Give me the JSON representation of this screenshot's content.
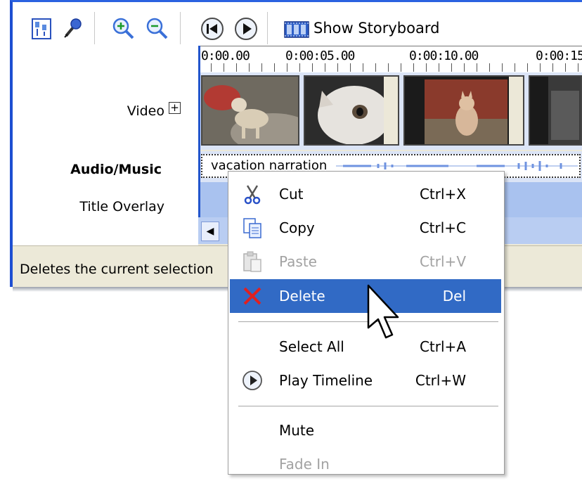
{
  "toolbar": {
    "show_storyboard_label": "Show Storyboard"
  },
  "tracks": {
    "video_label": "Video",
    "video_expand_symbol": "+",
    "audio_label": "Audio/Music",
    "title_overlay_label": "Title Overlay",
    "audio_clip_name": "vacation narration"
  },
  "ruler": {
    "ticks": [
      "0:00.00",
      "0:00:05.00",
      "0:00:10.00",
      "0:00:15"
    ]
  },
  "status": {
    "text": "Deletes the current selection"
  },
  "context_menu": {
    "items": [
      {
        "label": "Cut",
        "shortcut": "Ctrl+X",
        "icon": "scissors-icon",
        "enabled": true
      },
      {
        "label": "Copy",
        "shortcut": "Ctrl+C",
        "icon": "copy-icon",
        "enabled": true
      },
      {
        "label": "Paste",
        "shortcut": "Ctrl+V",
        "icon": "paste-icon",
        "enabled": false
      },
      {
        "label": "Delete",
        "shortcut": "Del",
        "icon": "delete-x-icon",
        "enabled": true,
        "highlighted": true
      },
      {
        "label": "Select All",
        "shortcut": "Ctrl+A",
        "enabled": true
      },
      {
        "label": "Play Timeline",
        "shortcut": "Ctrl+W",
        "icon": "play-icon",
        "enabled": true
      },
      {
        "label": "Mute",
        "enabled": true
      },
      {
        "label": "Fade In",
        "enabled": false
      }
    ]
  },
  "colors": {
    "highlight": "#316ac5",
    "title_bar": "#2b62e0",
    "track_bg": "#dbe4f6",
    "title_track": "#a9c2ef",
    "delete_red": "#e02020"
  }
}
